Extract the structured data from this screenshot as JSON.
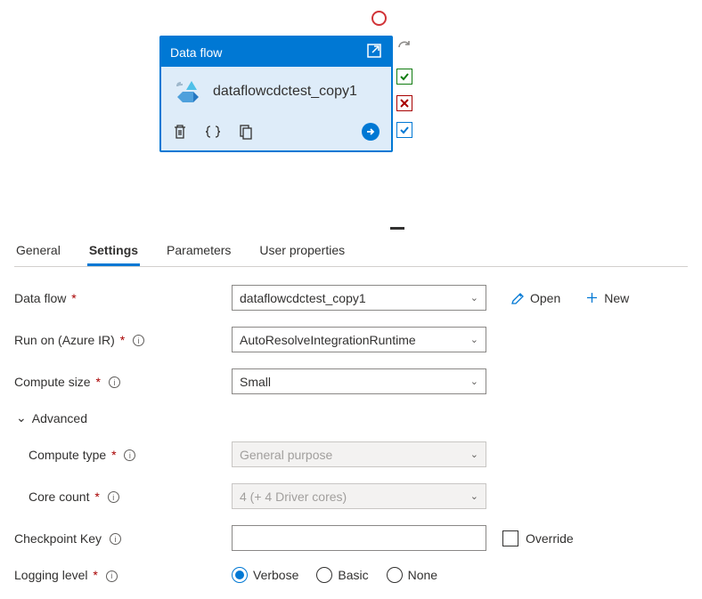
{
  "activity": {
    "header": "Data flow",
    "title": "dataflowcdctest_copy1"
  },
  "tabs": [
    "General",
    "Settings",
    "Parameters",
    "User properties"
  ],
  "active_tab": "Settings",
  "form": {
    "data_flow": {
      "label": "Data flow",
      "value": "dataflowcdctest_copy1"
    },
    "open_btn": "Open",
    "new_btn": "New",
    "run_on": {
      "label": "Run on (Azure IR)",
      "value": "AutoResolveIntegrationRuntime"
    },
    "compute_size": {
      "label": "Compute size",
      "value": "Small"
    },
    "advanced": "Advanced",
    "compute_type": {
      "label": "Compute type",
      "value": "General purpose"
    },
    "core_count": {
      "label": "Core count",
      "value": "4 (+ 4 Driver cores)"
    },
    "checkpoint": {
      "label": "Checkpoint Key",
      "value": "",
      "override": "Override"
    },
    "logging": {
      "label": "Logging level",
      "options": [
        "Verbose",
        "Basic",
        "None"
      ],
      "selected": "Verbose"
    }
  }
}
